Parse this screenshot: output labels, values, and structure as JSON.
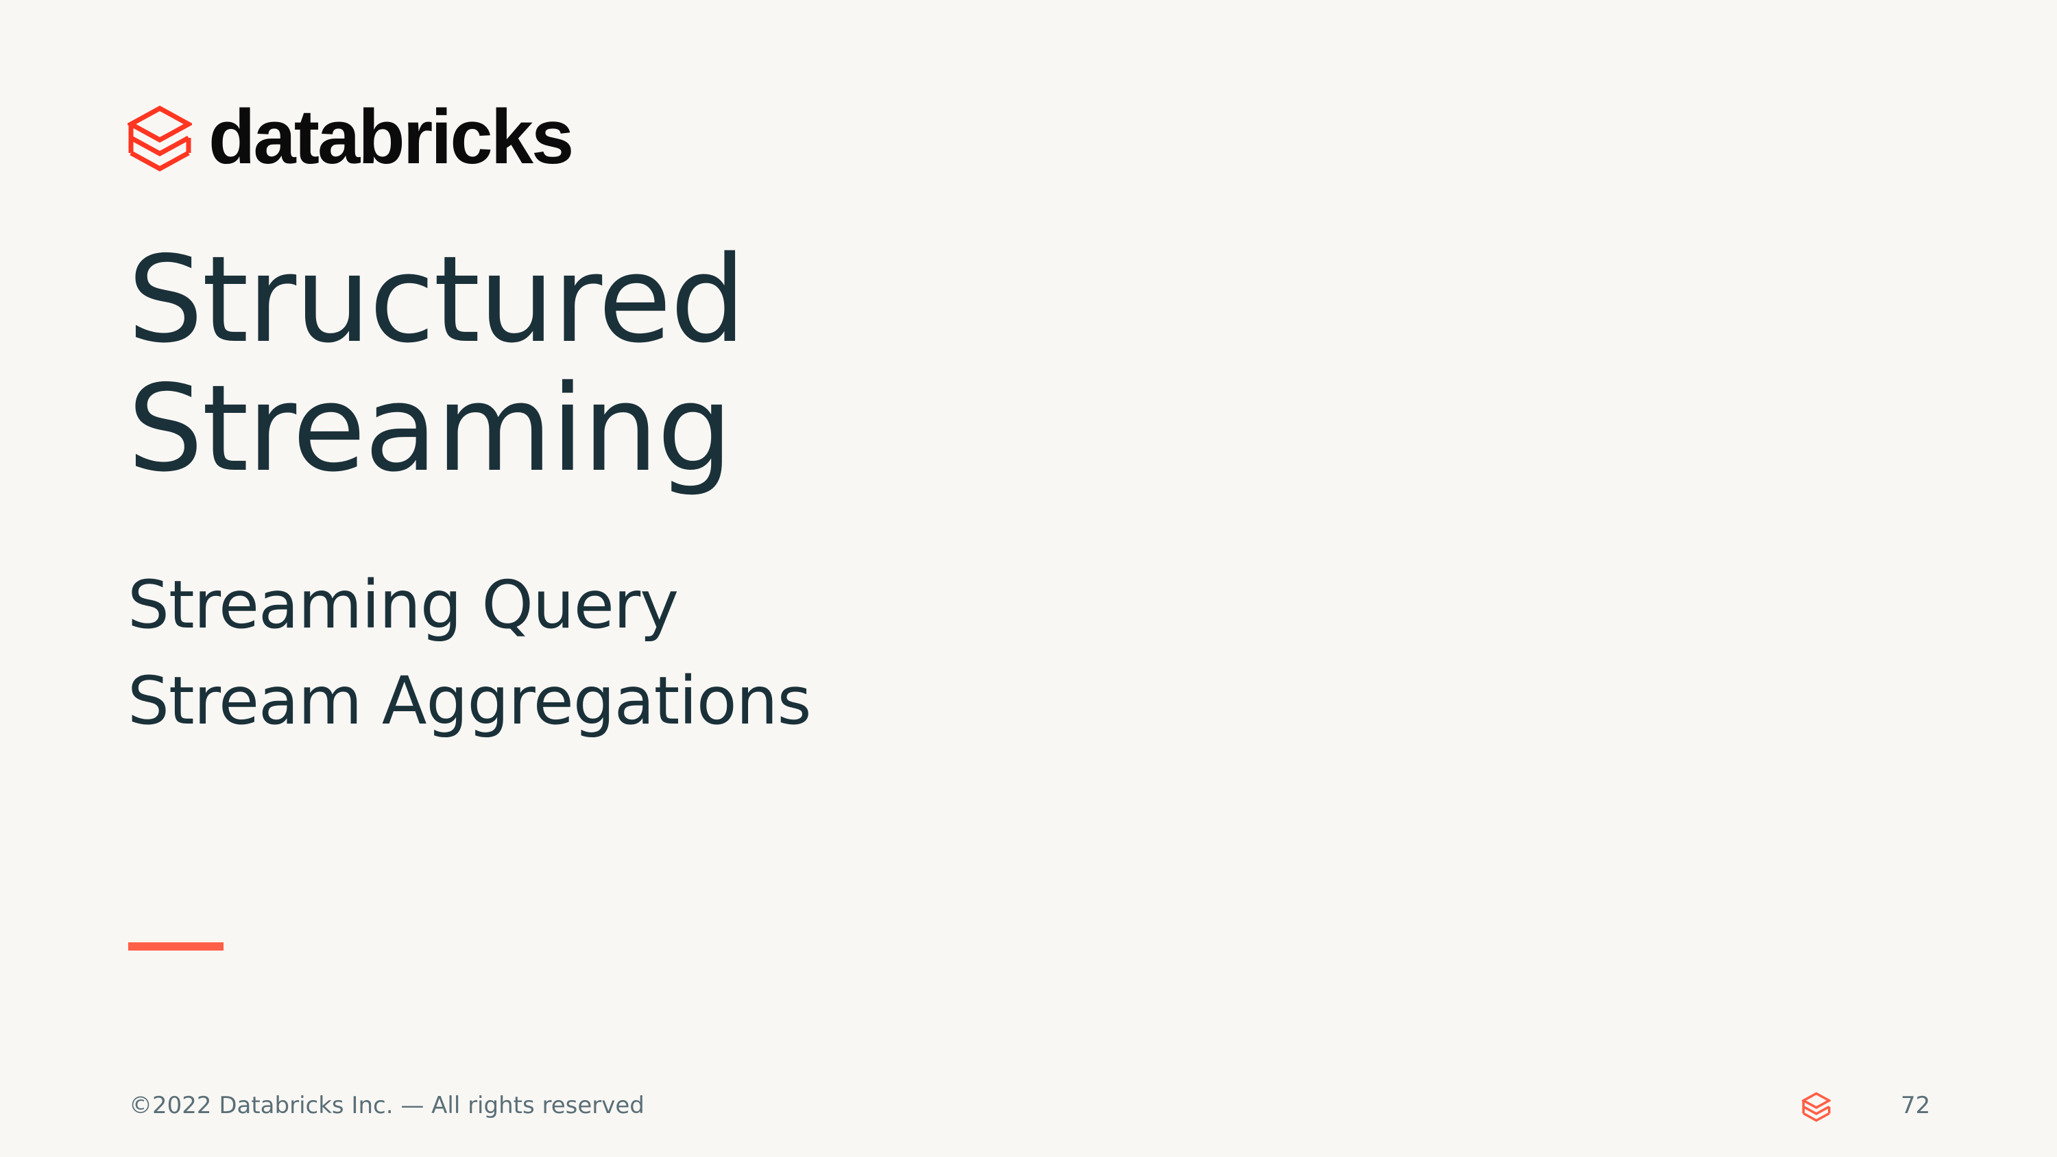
{
  "brand": {
    "name": "databricks",
    "logo_icon": "databricks-stack-icon",
    "accent_color": "#ff5f46",
    "text_color": "#1b3139"
  },
  "slide": {
    "title_lines": [
      "Structured",
      "Streaming"
    ],
    "topics": [
      "Streaming Query",
      "Stream Aggregations"
    ]
  },
  "footer": {
    "copyright": "©2022 Databricks Inc. — All rights reserved",
    "page_number": "72"
  }
}
